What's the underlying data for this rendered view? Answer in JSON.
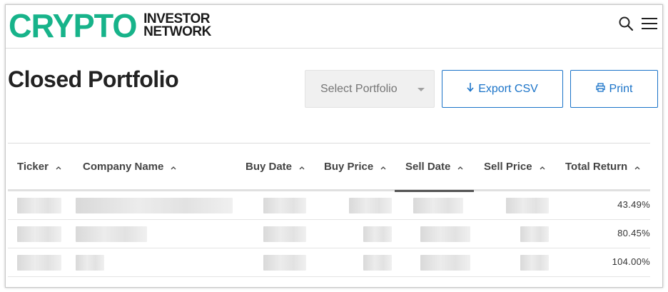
{
  "header": {
    "logo_main": "CRYPTO",
    "logo_sub_line1": "INVESTOR",
    "logo_sub_line2": "NETWORK",
    "logo_color": "#17b38a"
  },
  "page": {
    "title": "Closed Portfolio",
    "select_placeholder": "Select Portfolio",
    "export_label": "Export CSV",
    "print_label": "Print",
    "accent_color": "#1a73c8"
  },
  "table": {
    "columns": [
      "Ticker",
      "Company Name",
      "Buy Date",
      "Buy Price",
      "Sell Date",
      "Sell Price",
      "Total Return"
    ],
    "active_sort_column": "Sell Date",
    "rows": [
      {
        "total_return": "43.49%"
      },
      {
        "total_return": "80.45%"
      },
      {
        "total_return": "104.00%"
      }
    ]
  },
  "icons": [
    "search-icon",
    "menu-icon",
    "arrow-down-icon",
    "printer-icon",
    "sort-arrow-icon",
    "dropdown-caret-icon"
  ]
}
